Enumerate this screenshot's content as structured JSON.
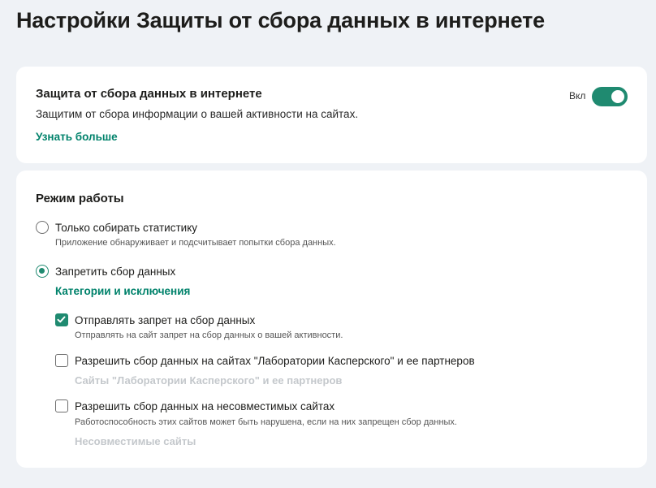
{
  "page": {
    "title": "Настройки Защиты от сбора данных в интернете"
  },
  "protection": {
    "title": "Защита от сбора данных в интернете",
    "description": "Защитим от сбора информации о вашей активности на сайтах.",
    "learn_more": "Узнать больше",
    "toggle_label": "Вкл",
    "toggle_on": true
  },
  "mode": {
    "title": "Режим работы",
    "options": [
      {
        "label": "Только собирать статистику",
        "description": "Приложение обнаруживает и подсчитывает попытки сбора данных.",
        "selected": false
      },
      {
        "label": "Запретить сбор данных",
        "link": "Категории и исключения",
        "selected": true
      }
    ],
    "checkboxes": [
      {
        "label": "Отправлять запрет на сбор данных",
        "description": "Отправлять на сайт запрет на сбор данных о вашей активности.",
        "checked": true
      },
      {
        "label": "Разрешить сбор данных на сайтах \"Лаборатории Касперского\" и ее партнеров",
        "link": "Сайты \"Лаборатории Касперского\" и ее партнеров",
        "checked": false
      },
      {
        "label": "Разрешить сбор данных на несовместимых сайтах",
        "description": "Работоспособность этих сайтов может быть нарушена, если на них запрещен сбор данных.",
        "link": "Несовместимые сайты",
        "checked": false
      }
    ]
  },
  "colors": {
    "accent": "#1f8a70",
    "link": "#00826b",
    "background": "#eff2f6",
    "disabled_link": "#c4c8cc"
  }
}
